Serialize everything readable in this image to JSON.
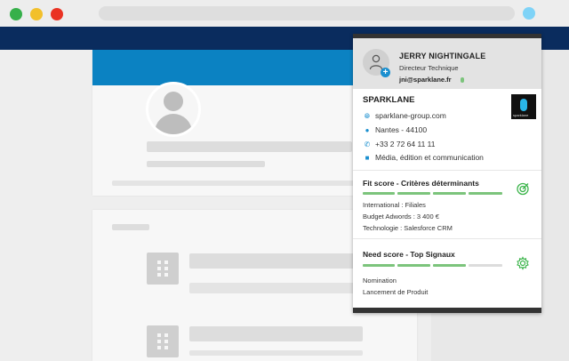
{
  "browser": {
    "window_controls": [
      "green",
      "yellow",
      "red"
    ],
    "extension_icon": "sparklane-extension-icon"
  },
  "contact": {
    "name": "JERRY NIGHTINGALE",
    "title": "Directeur Technique",
    "email": "jni@sparklane.fr",
    "avatar_icon": "user-icon",
    "add_icon": "plus-icon"
  },
  "company": {
    "name": "SPARKLANE",
    "logo_text": "sparklane",
    "website": "sparklane-group.com",
    "location": "Nantes - 44100",
    "phone": "+33 2 72 64 11 11",
    "industry": "Média, édition et communication",
    "icons": [
      "globe-icon",
      "location-pin-icon",
      "phone-icon",
      "industry-icon"
    ]
  },
  "fit_score": {
    "title": "Fit score - Critères déterminants",
    "segments_filled": 4,
    "segments_total": 4,
    "lines": [
      "International : Filiales",
      "Budget Adwords : 3 400 €",
      "Technologie : Salesforce CRM"
    ],
    "icon": "target-icon"
  },
  "need_score": {
    "title": "Need score - Top Signaux",
    "segments_filled": 3,
    "segments_total": 4,
    "lines": [
      "Nomination",
      "Lancement de Produit"
    ],
    "icon": "gear-icon"
  },
  "colors": {
    "accent_blue": "#1a8fcf",
    "score_green": "#7cc47c",
    "navbar": "#0a2c5e",
    "banner": "#0b82c2"
  }
}
